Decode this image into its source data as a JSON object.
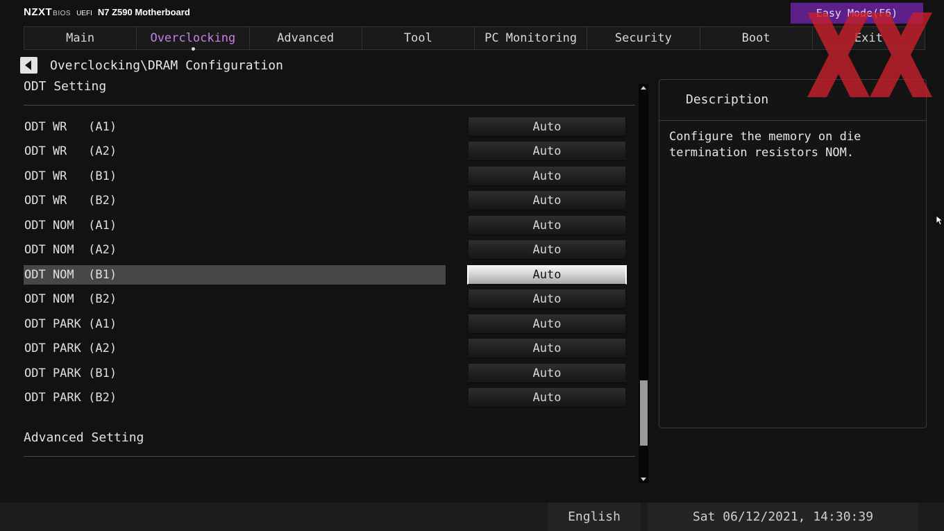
{
  "brand": {
    "logo": "NZXT",
    "bios": "BIOS",
    "uefi": "UEFI",
    "model": "N7 Z590 Motherboard"
  },
  "easy_mode": {
    "label": "Easy Mode(F6)"
  },
  "tabs": [
    {
      "label": "Main",
      "active": false
    },
    {
      "label": "Overclocking",
      "active": true
    },
    {
      "label": "Advanced",
      "active": false
    },
    {
      "label": "Tool",
      "active": false
    },
    {
      "label": "PC Monitoring",
      "active": false
    },
    {
      "label": "Security",
      "active": false
    },
    {
      "label": "Boot",
      "active": false
    },
    {
      "label": "Exit",
      "active": false
    }
  ],
  "breadcrumb": "Overclocking\\DRAM Configuration",
  "sections": {
    "odt": "ODT Setting",
    "advanced": "Advanced Setting"
  },
  "settings": [
    {
      "label": "ODT WR   (A1)",
      "value": "Auto"
    },
    {
      "label": "ODT WR   (A2)",
      "value": "Auto"
    },
    {
      "label": "ODT WR   (B1)",
      "value": "Auto"
    },
    {
      "label": "ODT WR   (B2)",
      "value": "Auto"
    },
    {
      "label": "ODT NOM  (A1)",
      "value": "Auto"
    },
    {
      "label": "ODT NOM  (A2)",
      "value": "Auto"
    },
    {
      "label": "ODT NOM  (B1)",
      "value": "Auto",
      "selected": true
    },
    {
      "label": "ODT NOM  (B2)",
      "value": "Auto"
    },
    {
      "label": "ODT PARK (A1)",
      "value": "Auto"
    },
    {
      "label": "ODT PARK (A2)",
      "value": "Auto"
    },
    {
      "label": "ODT PARK (B1)",
      "value": "Auto"
    },
    {
      "label": "ODT PARK (B2)",
      "value": "Auto"
    }
  ],
  "description": {
    "title": "Description",
    "text": "Configure the memory on die\ntermination resistors NOM."
  },
  "footer": {
    "language": "English",
    "datetime": "Sat 06/12/2021, 14:30:39"
  },
  "colors": {
    "accent": "#c680e8",
    "easy_mode_bg": "#5d1f8a",
    "watermark": "#c8202c"
  }
}
